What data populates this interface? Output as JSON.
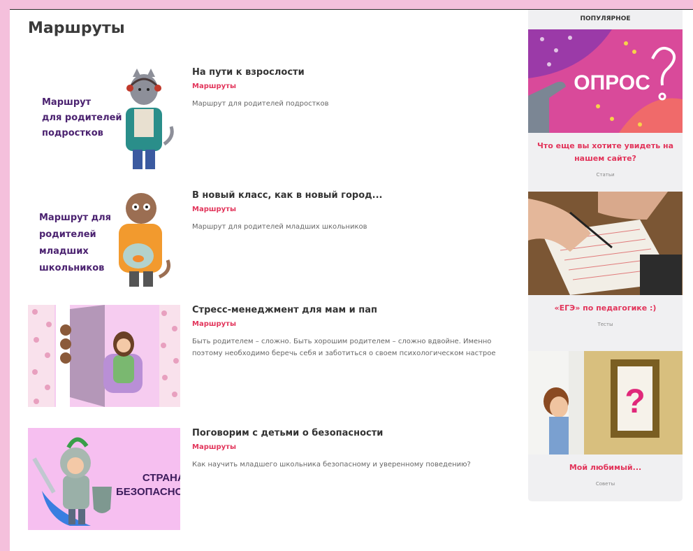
{
  "page": {
    "title": "Маршруты"
  },
  "articles": [
    {
      "title": "На пути к взрослости",
      "category": "Маршруты",
      "description": "Маршрут для родителей подростков",
      "thumb_lines": [
        "Маршрут",
        "для родителей",
        "подростков"
      ]
    },
    {
      "title": "В новый класс, как в новый город...",
      "category": "Маршруты",
      "description": "Маршрут для родителей младших школьников",
      "thumb_lines": [
        "Маршрут для",
        "родителей",
        "младших",
        "школьников"
      ]
    },
    {
      "title": "Стресс-менеджмент для мам и пап",
      "category": "Маршруты",
      "description": "Быть родителем – сложно. Быть хорошим родителем – сложно вдвойне. Именно поэтому необходимо беречь себя и заботиться о своем психологическом настрое"
    },
    {
      "title": "Поговорим с детьми о безопасности",
      "category": "Маршруты",
      "description": "Как научить младшего школьника безопасному и уверенному поведению?",
      "thumb_lines": [
        "СТРАНА",
        "БЕЗОПАСНОСТИ"
      ]
    }
  ],
  "sidebar": {
    "heading": "ПОПУЛЯРНОЕ",
    "cards": [
      {
        "title": "Что еще вы хотите увидеть на нашем сайте?",
        "category": "Статьи",
        "image_text": "ОПРОС"
      },
      {
        "title": "«ЕГЭ» по педагогике :)",
        "category": "Тесты"
      },
      {
        "title": "Мой любимый...",
        "category": "Советы",
        "image_text": "?"
      }
    ]
  },
  "colors": {
    "accent": "#e2355b",
    "background": "#f4c0dc",
    "thumb_text": "#4b2270"
  }
}
